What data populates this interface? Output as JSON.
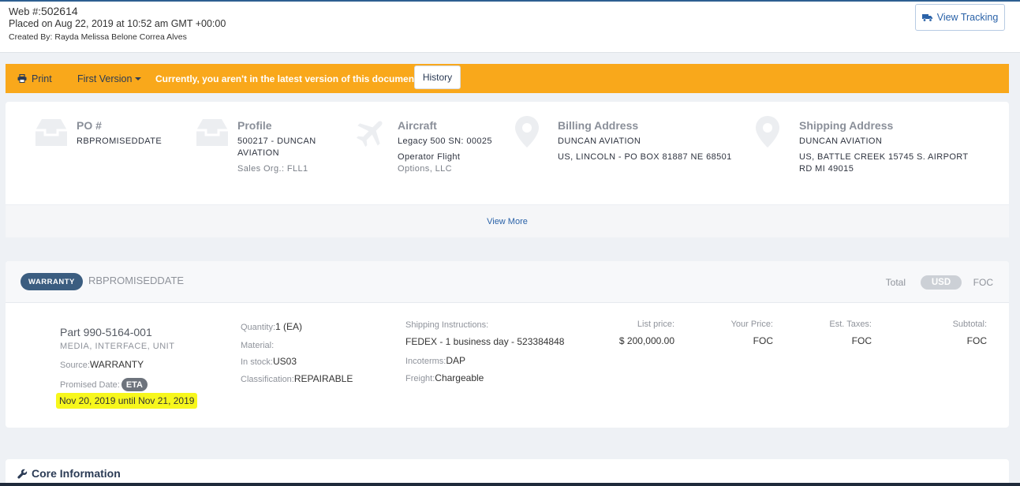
{
  "header": {
    "web_label": "Web #:",
    "web_number": "502614",
    "placed": "Placed on Aug 22, 2019 at 10:52 am GMT +00:00",
    "created_by": "Created By: Rayda Melissa Belone Correa Alves",
    "view_tracking": "View Tracking"
  },
  "version_bar": {
    "print": "Print",
    "first_version": "First Version",
    "message": "Currently, you aren't in the latest version of this document.",
    "history": "History",
    "color": "#f9a81b"
  },
  "info": {
    "po": {
      "title": "PO #",
      "value": "RBPROMISEDDATE",
      "icon": "inbox-icon"
    },
    "profile": {
      "title": "Profile",
      "line1": "500217 - DUNCAN",
      "line2": "AVIATION",
      "sub": "Sales Org.: FLL1",
      "icon": "inbox-icon"
    },
    "aircraft": {
      "title": "Aircraft",
      "line1": "Legacy 500 SN: 00025",
      "sub1": "Operator Flight",
      "sub2": "Options, LLC",
      "icon": "plane-icon"
    },
    "billing": {
      "title": "Billing Address",
      "line1": "DUNCAN AVIATION",
      "line2": "US, LINCOLN - PO BOX 81887 NE 68501",
      "icon": "map-marker-icon"
    },
    "shipping": {
      "title": "Shipping Address",
      "line1": "DUNCAN AVIATION",
      "line2": "US, BATTLE CREEK 15745 S. AIRPORT",
      "line3": "RD MI 49015",
      "icon": "map-marker-icon"
    },
    "view_more": "View More"
  },
  "item": {
    "badge": "WARRANTY",
    "title": "RBPROMISEDDATE",
    "total_label": "Total",
    "currency": "USD",
    "total_value": "FOC",
    "part": "Part 990-5164-001",
    "description": "MEDIA, INTERFACE, UNIT",
    "source_label": "Source:",
    "source_value": "WARRANTY",
    "promised_label": "Promised Date:",
    "eta": "ETA",
    "eta_range": "Nov 20, 2019 until Nov 21, 2019",
    "quantity_label": "Quantity:",
    "quantity_value": "1 (EA)",
    "material_label": "Material:",
    "instock_label": "In stock:",
    "instock_value": "US03",
    "classification_label": "Classification:",
    "classification_value": "REPAIRABLE",
    "shipping_instr_label": "Shipping Instructions:",
    "shipping_instr_value": "FEDEX - 1 business day - 523384848",
    "incoterms_label": "Incoterms:",
    "incoterms_value": "DAP",
    "freight_label": "Freight:",
    "freight_value": "Chargeable",
    "list_price_label": "List price:",
    "list_price_value": "$ 200,000.00",
    "your_price_label": "Your Price:",
    "your_price_value": "FOC",
    "taxes_label": "Est. Taxes:",
    "taxes_value": "FOC",
    "subtotal_label": "Subtotal:",
    "subtotal_value": "FOC",
    "highlight_color": "#f7f71c"
  },
  "core": {
    "title": "Core Information",
    "icon": "wrench-icon"
  }
}
